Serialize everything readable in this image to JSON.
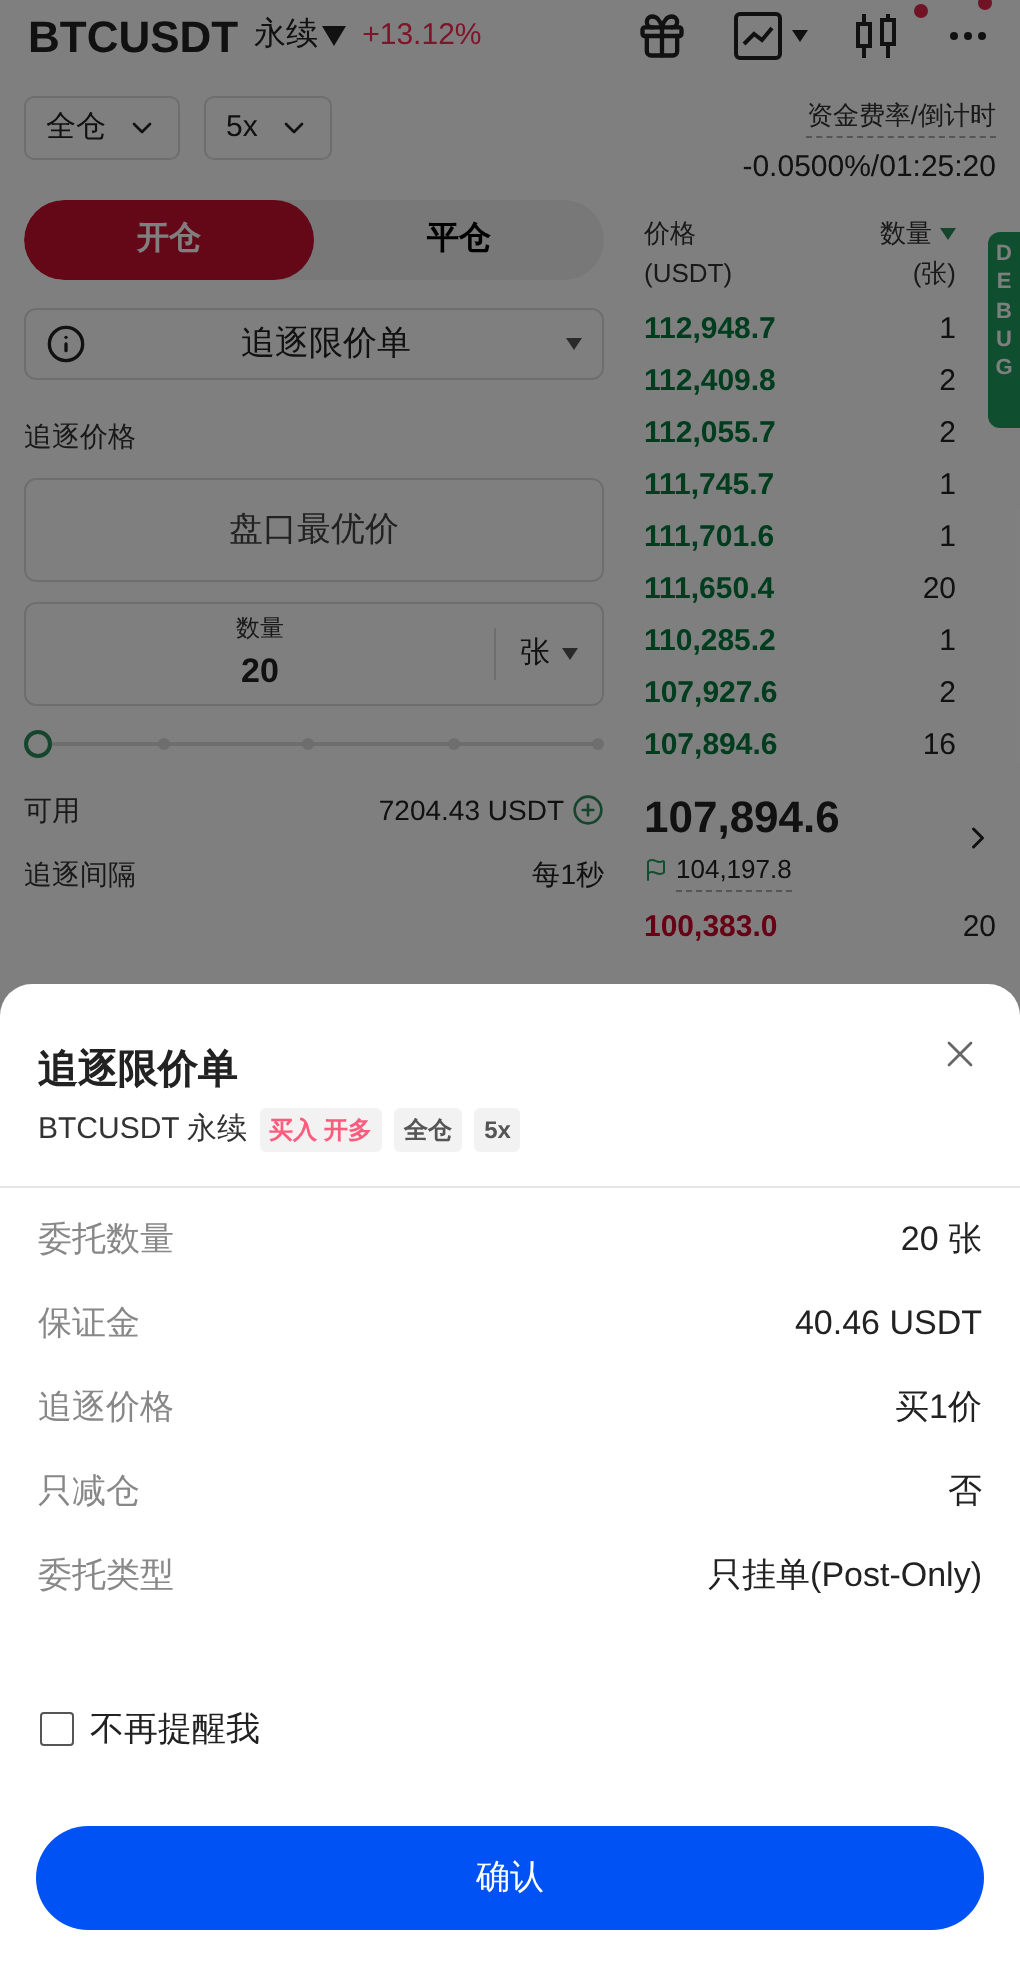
{
  "header": {
    "symbol": "BTCUSDT",
    "contract": "永续",
    "change": "+13.12%"
  },
  "margin_mode": "全仓",
  "leverage": "5x",
  "funding": {
    "label": "资金费率/倒计时",
    "value": "-0.0500%/01:25:20"
  },
  "tabs": [
    {
      "label": "开仓",
      "selected": true
    },
    {
      "label": "平仓",
      "selected": false
    }
  ],
  "order_type": "追逐限价单",
  "chase_price": {
    "label": "追逐价格",
    "placeholder": "盘口最优价"
  },
  "quantity": {
    "label": "数量",
    "value": "20",
    "unit": "张"
  },
  "slider": {
    "level": 0
  },
  "info": [
    {
      "label": "可用",
      "value": "7204.43 USDT",
      "kind": "add"
    },
    {
      "label": "追逐间隔",
      "value": "每1秒",
      "kind": "plain"
    }
  ],
  "orderbook": {
    "price_header": "价格",
    "price_unit": "(USDT)",
    "qty_header": "数量",
    "qty_unit": "(张)",
    "asks": [
      {
        "price": "112,948.7",
        "qty": "1"
      },
      {
        "price": "112,409.8",
        "qty": "2"
      },
      {
        "price": "112,055.7",
        "qty": "2"
      },
      {
        "price": "111,745.7",
        "qty": "1"
      },
      {
        "price": "111,701.6",
        "qty": "1"
      },
      {
        "price": "111,650.4",
        "qty": "20"
      },
      {
        "price": "110,285.2",
        "qty": "1"
      },
      {
        "price": "107,927.6",
        "qty": "2"
      },
      {
        "price": "107,894.6",
        "qty": "16"
      }
    ],
    "last_price": "107,894.6",
    "mark_price": "104,197.8",
    "bids": [
      {
        "price": "100,383.0",
        "qty": "20"
      }
    ]
  },
  "debug_tab": "DEBUG",
  "dialog": {
    "title": "追逐限价单",
    "subtitle": "BTCUSDT 永续",
    "tags": [
      {
        "label": "买入 开多",
        "color": "#ff5b7d"
      },
      {
        "label": "全仓",
        "color": "#555555"
      },
      {
        "label": "5x",
        "color": "#555555"
      }
    ],
    "rows": [
      {
        "label": "委托数量",
        "value": "20 张"
      },
      {
        "label": "保证金",
        "value": "40.46 USDT"
      },
      {
        "label": "追逐价格",
        "value": "买1价"
      },
      {
        "label": "只减仓",
        "value": "否"
      },
      {
        "label": "委托类型",
        "value": "只挂单(Post-Only)"
      }
    ],
    "dont_remind": {
      "label": "不再提醒我",
      "checked": false
    },
    "confirm": "确认"
  }
}
